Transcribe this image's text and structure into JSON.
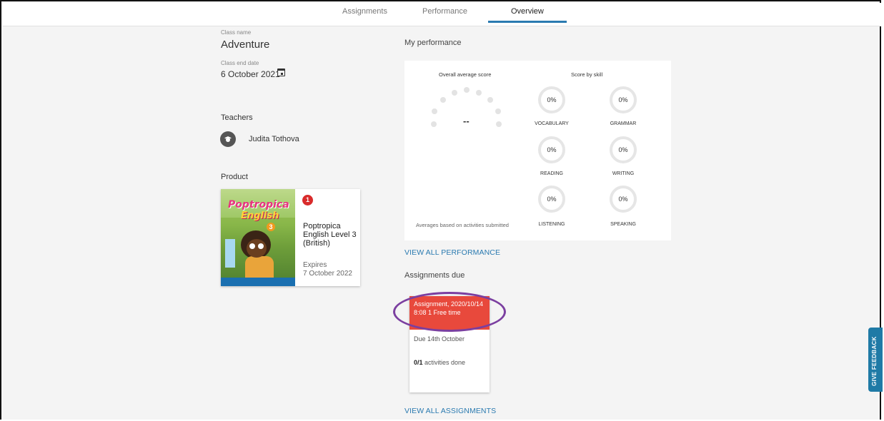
{
  "tabs": [
    {
      "label": "Assignments",
      "active": false
    },
    {
      "label": "Performance",
      "active": false
    },
    {
      "label": "Overview",
      "active": true
    }
  ],
  "class_info": {
    "name_label": "Class name",
    "name": "Adventure",
    "end_date_label": "Class end date",
    "end_date": "6 October 2021"
  },
  "teachers": {
    "heading": "Teachers",
    "items": [
      {
        "name": "Judita Tothova",
        "icon": "graduation-cap-icon"
      }
    ]
  },
  "product": {
    "heading": "Product",
    "badge": "1",
    "title": "Poptropica English Level 3 (British)",
    "expires_label": "Expires",
    "expires_date": "7 October 2022",
    "cover": {
      "logo_line1": "Poptropica",
      "logo_line2": "English",
      "level": "3"
    }
  },
  "performance": {
    "heading": "My performance",
    "overall_label": "Overall average score",
    "overall_value": "--",
    "score_by_skill_label": "Score by skill",
    "note": "Averages based on activities submitted",
    "skills": [
      {
        "name": "VOCABULARY",
        "value": "0%"
      },
      {
        "name": "GRAMMAR",
        "value": "0%"
      },
      {
        "name": "READING",
        "value": "0%"
      },
      {
        "name": "WRITING",
        "value": "0%"
      },
      {
        "name": "LISTENING",
        "value": "0%"
      },
      {
        "name": "SPEAKING",
        "value": "0%"
      }
    ],
    "view_all": "VIEW ALL PERFORMANCE"
  },
  "assignments": {
    "heading": "Assignments due",
    "items": [
      {
        "title": "Assignment, 2020/10/14 8:08 1 Free time",
        "due": "Due 14th October",
        "done_count": "0/1",
        "done_label": " activities done"
      }
    ],
    "view_all": "VIEW ALL ASSIGNMENTS"
  },
  "feedback_button": "GIVE FEEDBACK",
  "colors": {
    "accent": "#2a7ab0",
    "assignment_header": "#e8493c",
    "badge": "#d92b2b",
    "highlight": "#7b3fa0"
  }
}
